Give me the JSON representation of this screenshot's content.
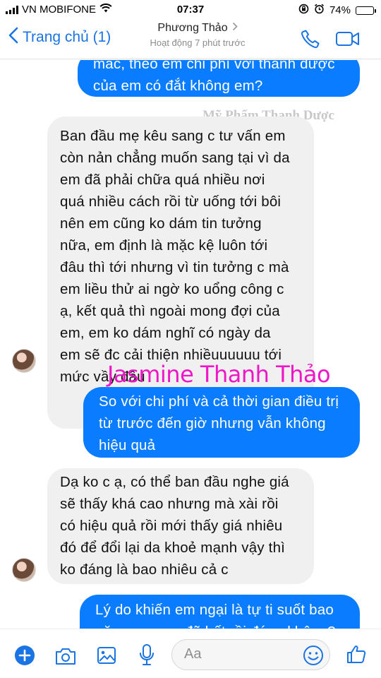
{
  "status": {
    "carrier": "VN MOBIFONE",
    "time": "07:37",
    "battery_pct": "74%",
    "battery_level": 0.74
  },
  "header": {
    "back_label": "Trang chủ (1)",
    "contact_name": "Phương Thảo",
    "contact_status": "Hoạt động 7 phút trước"
  },
  "watermark": "Mỹ Phẩm Thanh Dược",
  "signature": "Jasmine Thanh Thảo",
  "messages": [
    {
      "direction": "outgoing",
      "lines": [
        "mắc, theo em chi phí với thanh dược",
        "của em có đắt không em?"
      ]
    },
    {
      "direction": "incoming",
      "lines": [
        "Ban đầu mẹ kêu sang c tư vấn em",
        "còn nản chẳng muốn sang tại vì da",
        "em đã phải chữa quá nhiều nơi",
        "quá nhiều cách rồi từ uống tới bôi",
        "nên em cũng ko dám tin tưởng",
        "nữa, em định là mặc kệ luôn tới",
        "đâu thì tới nhưng vì tin tưởng c mà",
        "em liều thử ai ngờ ko uổng công c",
        "ạ, kết quả thì ngoài mong đợi của",
        "em, em ko dám nghĩ có ngày da",
        "em sẽ đc cải thiện nhiềuuuuuu tới",
        "mức vầy đâu"
      ]
    },
    {
      "direction": "outgoing",
      "lines": [
        "So với chi phí và cả thời gian điều trị",
        "từ trước đến giờ nhưng vẫn không",
        "hiệu quả"
      ]
    },
    {
      "direction": "incoming",
      "lines": [
        "Dạ ko c ạ, có thể ban đầu nghe giá",
        "sẽ thấy khá cao nhưng mà xài rồi",
        "có hiệu quả rồi mới thấy giá nhiêu",
        "đó để đổi lại da khoẻ mạnh vậy thì",
        "ko đáng là bao nhiêu cả c"
      ]
    },
    {
      "direction": "outgoing",
      "lines": [
        "Lý do khiến em ngại là tự ti suốt bao",
        "năm qua nay đã hết rồi đúng không?"
      ]
    }
  ],
  "composer": {
    "placeholder": "Aa"
  },
  "colors": {
    "accent": "#1b74e4",
    "outgoing_bubble": "#0a7cff",
    "incoming_bubble": "#f1f0f0",
    "signature": "#ee16c6"
  },
  "icons": [
    "wifi-icon",
    "back-chevron-icon",
    "phone-icon",
    "video-icon",
    "plus-icon",
    "camera-icon",
    "gallery-icon",
    "mic-icon",
    "emoji-icon",
    "like-icon"
  ]
}
